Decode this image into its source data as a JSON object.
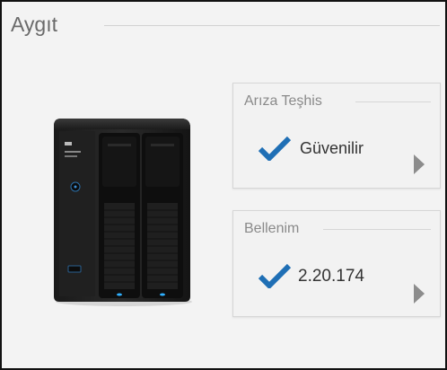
{
  "section": {
    "title": "Aygıt"
  },
  "device_image": {
    "icon": "nas-device-image",
    "brand_text": "WD",
    "model_text": "My Cloud PR2100"
  },
  "cards": {
    "diagnostics": {
      "title": "Arıza Teşhis",
      "status_icon": "check-icon",
      "value": "Güvenilir",
      "action_icon": "chevron-right-icon"
    },
    "firmware": {
      "title": "Bellenim",
      "status_icon": "check-icon",
      "value": "2.20.174",
      "action_icon": "chevron-right-icon"
    }
  },
  "colors": {
    "check": "#1f6fb5",
    "chevron": "#8c8c8c",
    "text": "#333333",
    "muted": "#8a8a8a"
  }
}
